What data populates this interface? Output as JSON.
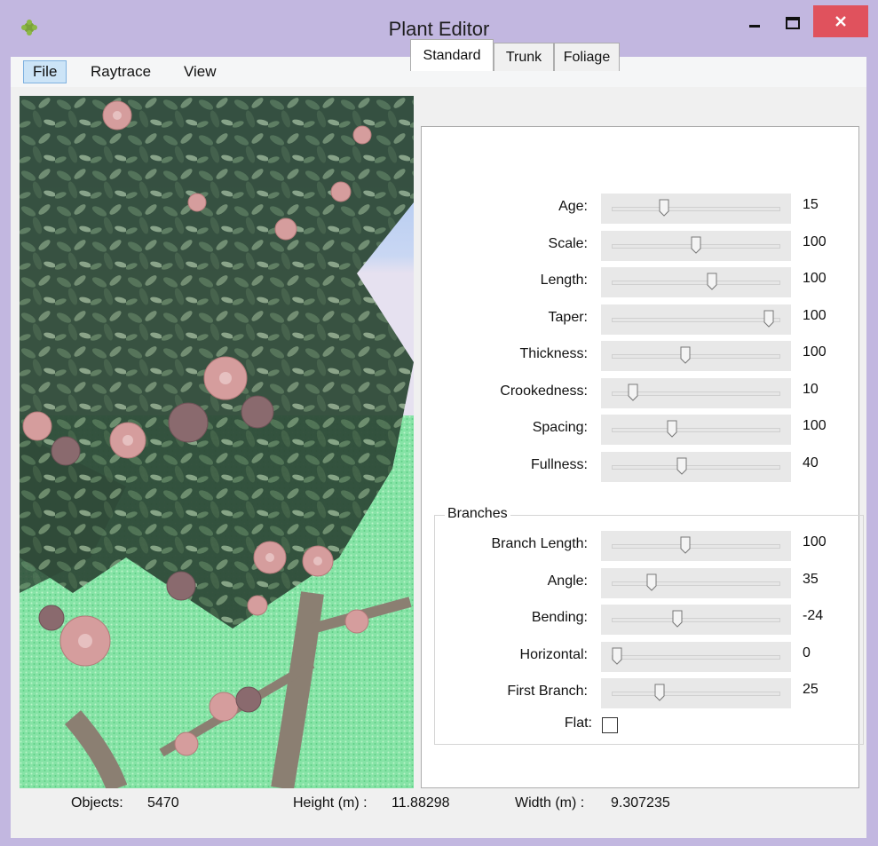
{
  "window": {
    "title": "Plant Editor"
  },
  "menu": {
    "items": [
      "File",
      "Raytrace",
      "View"
    ]
  },
  "tabs": [
    "Standard",
    "Trunk",
    "Foliage"
  ],
  "standard": [
    {
      "label": "Age:",
      "value": "15",
      "level": 0.3
    },
    {
      "label": "Scale:",
      "value": "100",
      "level": 0.5
    },
    {
      "label": "Length:",
      "value": "100",
      "level": 0.6
    },
    {
      "label": "Taper:",
      "value": "100",
      "level": 0.96
    },
    {
      "label": "Thickness:",
      "value": "100",
      "level": 0.43
    },
    {
      "label": "Crookedness:",
      "value": "10",
      "level": 0.1
    },
    {
      "label": "Spacing:",
      "value": "100",
      "level": 0.35
    },
    {
      "label": "Fullness:",
      "value": "40",
      "level": 0.41
    }
  ],
  "branches": {
    "title": "Branches",
    "rows": [
      {
        "label": "Branch Length:",
        "value": "100",
        "level": 0.43
      },
      {
        "label": "Angle:",
        "value": "35",
        "level": 0.22
      },
      {
        "label": "Bending:",
        "value": "-24",
        "level": 0.38
      },
      {
        "label": "Horizontal:",
        "value": "0",
        "level": 0.0
      },
      {
        "label": "First Branch:",
        "value": "25",
        "level": 0.27
      }
    ],
    "flat_label": "Flat:",
    "flat_checked": false
  },
  "status": {
    "objects_label": "Objects:",
    "objects_value": "5470",
    "height_label": "Height (m) :",
    "height_value": "11.88298",
    "width_label": "Width (m) :",
    "width_value": "9.307235"
  },
  "colors": {
    "titlebar": "#c2b7e0",
    "close_button": "#e0525d",
    "menu_highlight": "#cce4f7"
  }
}
